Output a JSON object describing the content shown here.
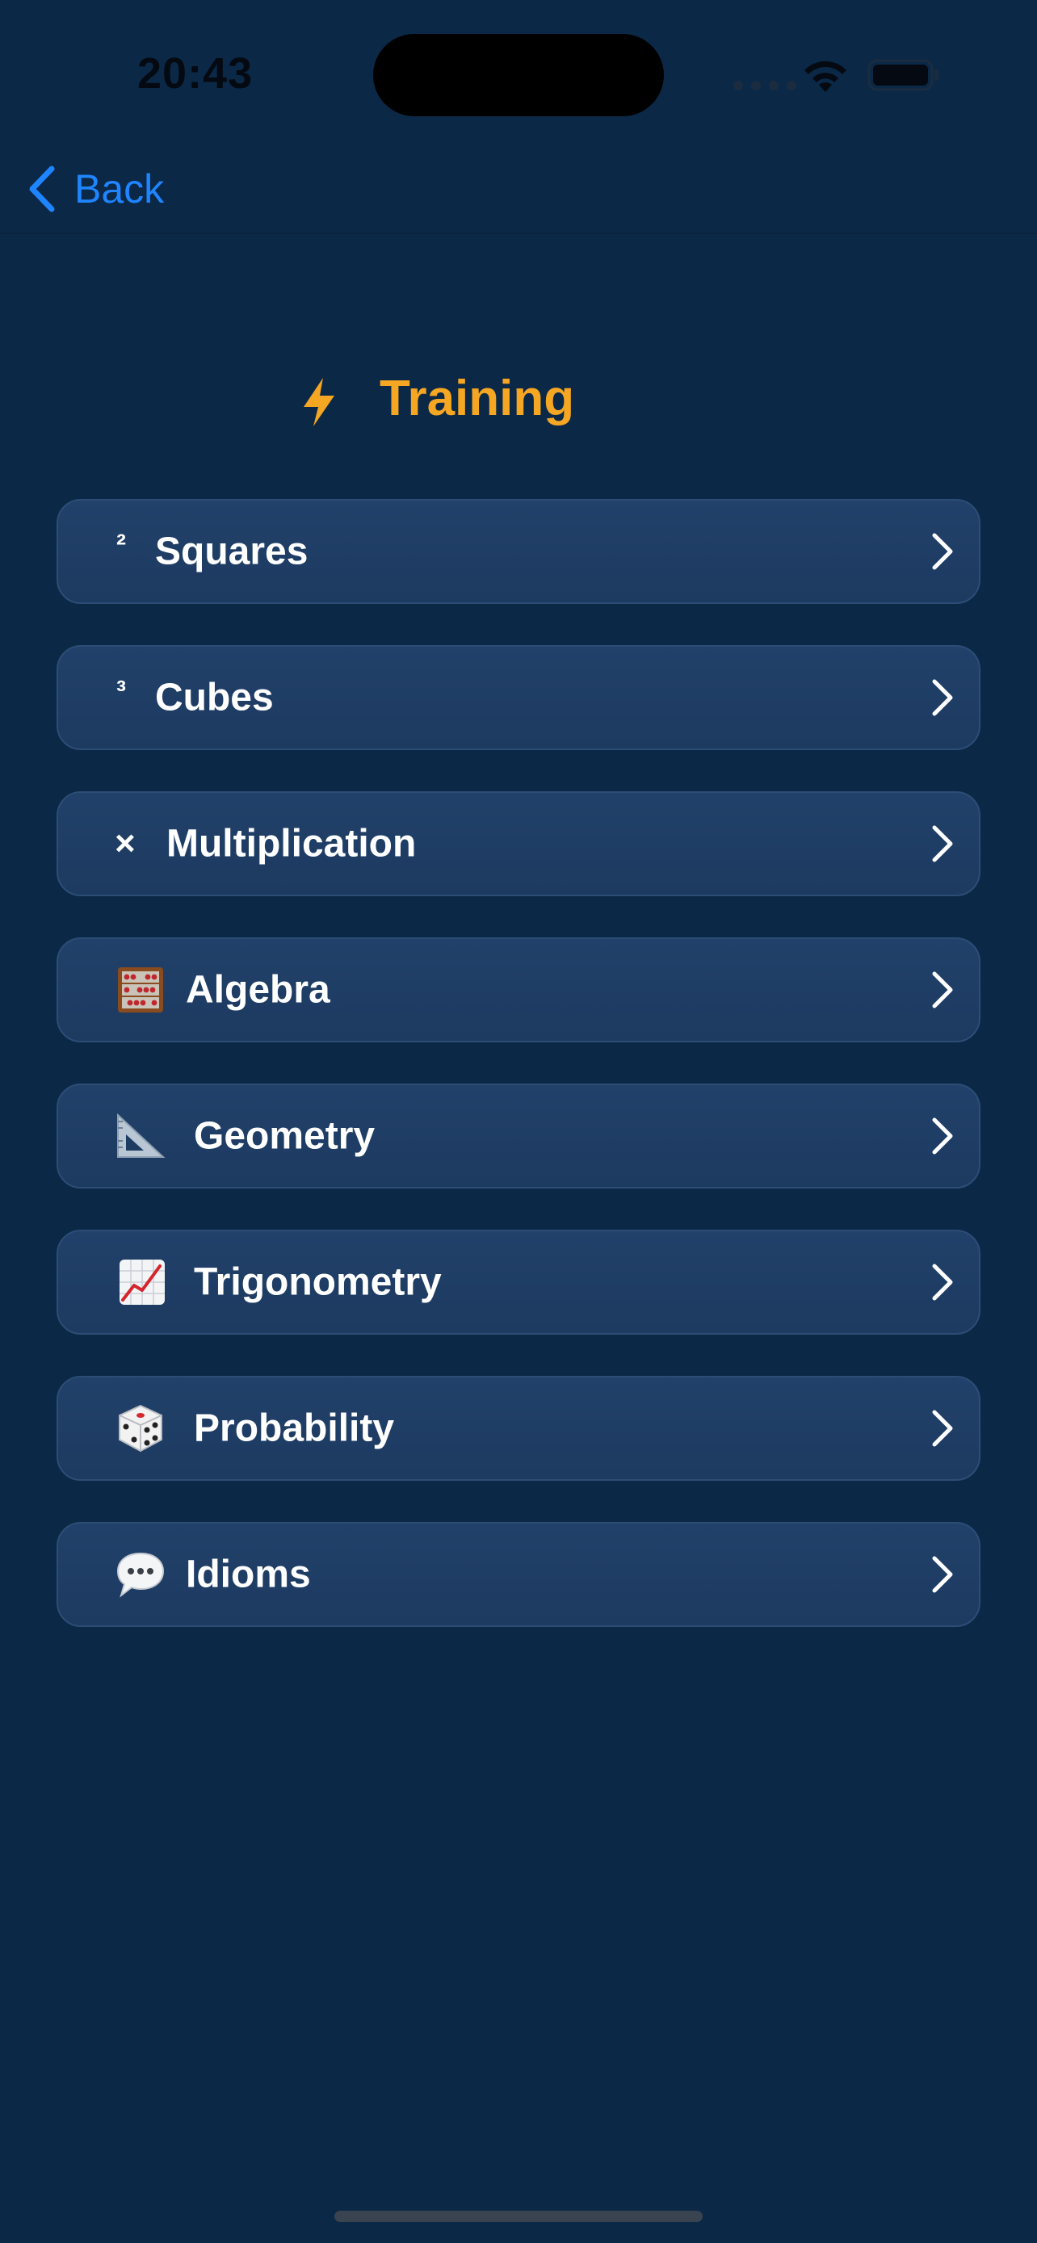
{
  "status_bar": {
    "time": "20:43"
  },
  "nav": {
    "back_label": "Back",
    "accent_color": "#1f84ff"
  },
  "header": {
    "title": "Training",
    "icon": "lightning-bolt-icon",
    "title_color": "#f5a623"
  },
  "menu": {
    "items": [
      {
        "id": "squares",
        "symbol": "²",
        "label": "Squares",
        "icon": "superscript-two-icon"
      },
      {
        "id": "cubes",
        "symbol": "³",
        "label": "Cubes",
        "icon": "superscript-three-icon"
      },
      {
        "id": "multiplication",
        "symbol": "×",
        "label": "Multiplication",
        "icon": "multiply-icon"
      },
      {
        "id": "algebra",
        "symbol": "",
        "label": "Algebra",
        "icon": "abacus-icon"
      },
      {
        "id": "geometry",
        "symbol": "",
        "label": "Geometry",
        "icon": "triangular-ruler-icon"
      },
      {
        "id": "trigonometry",
        "symbol": "",
        "label": "Trigonometry",
        "icon": "chart-increasing-icon"
      },
      {
        "id": "probability",
        "symbol": "",
        "label": "Probability",
        "icon": "dice-icon"
      },
      {
        "id": "idioms",
        "symbol": "",
        "label": "Idioms",
        "icon": "speech-bubble-icon"
      }
    ]
  }
}
